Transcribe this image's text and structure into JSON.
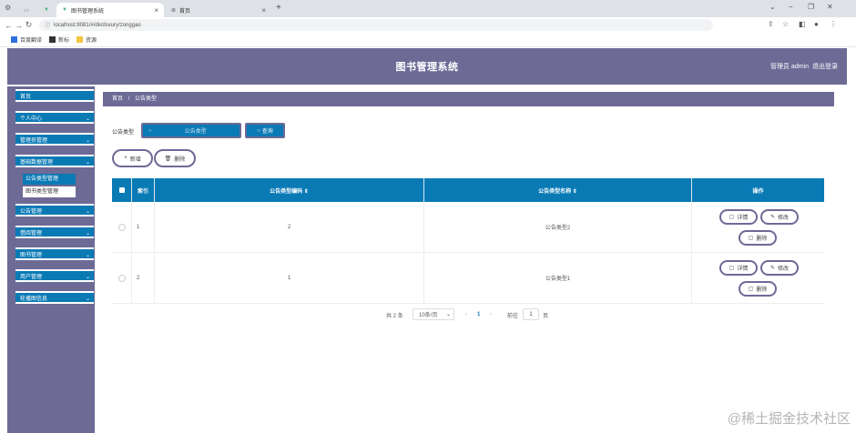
{
  "browser": {
    "tabs": [
      {
        "label": ""
      },
      {
        "label": "图书管理系统"
      },
      {
        "label": "首页"
      }
    ],
    "new_tab": "+",
    "url": "localhost:8081/#/dk/dsxury/zonggao",
    "bookmarks": [
      "百度翻译",
      "新标",
      "资源"
    ],
    "window_controls": [
      "⌄",
      "−",
      "❐",
      "✕"
    ]
  },
  "app": {
    "title": "图书管理系统",
    "admin": "管理员 admin",
    "logout": "退出登录"
  },
  "sidebar": {
    "items": [
      {
        "label": "首页",
        "chevron": ""
      },
      {
        "label": "个人中心",
        "chevron": "⌄"
      },
      {
        "label": "管理员管理",
        "chevron": "⌄"
      },
      {
        "label": "基础数据管理",
        "chevron": "⌄"
      },
      {
        "label": "公告管理",
        "chevron": "⌄"
      },
      {
        "label": "借阅管理",
        "chevron": "⌄"
      },
      {
        "label": "图书管理",
        "chevron": "⌄"
      },
      {
        "label": "用户管理",
        "chevron": "⌄"
      },
      {
        "label": "轮播图信息",
        "chevron": "⌄"
      }
    ],
    "subitems": [
      {
        "label": "公告类型管理"
      },
      {
        "label": "图书类型管理"
      }
    ]
  },
  "breadcrumb": {
    "home": "首页",
    "sep": "/",
    "current": "公告类型"
  },
  "search": {
    "label": "公告类型",
    "placeholder": "公告类型",
    "button": "查询"
  },
  "actions": {
    "add": "新增",
    "delete": "删除"
  },
  "table": {
    "headers": [
      "",
      "索引",
      "公告类型编码 ⇕",
      "公告类型名称 ⇕",
      "操作"
    ],
    "rows": [
      {
        "index": "1",
        "code": "2",
        "name": "公告类型2"
      },
      {
        "index": "2",
        "code": "1",
        "name": "公告类型1"
      }
    ],
    "row_buttons": {
      "detail": "详情",
      "edit": "修改",
      "delete": "删除"
    }
  },
  "pagination": {
    "total": "共 2 条",
    "page_size": "10条/页",
    "prev": "‹",
    "current": "1",
    "next": "›",
    "goto_label": "前往",
    "goto_value": "1",
    "goto_suffix": "页"
  },
  "watermark": "@稀土掘金技术社区",
  "colors": {
    "accent": "#0a7ab5",
    "header": "#6d6a96"
  }
}
